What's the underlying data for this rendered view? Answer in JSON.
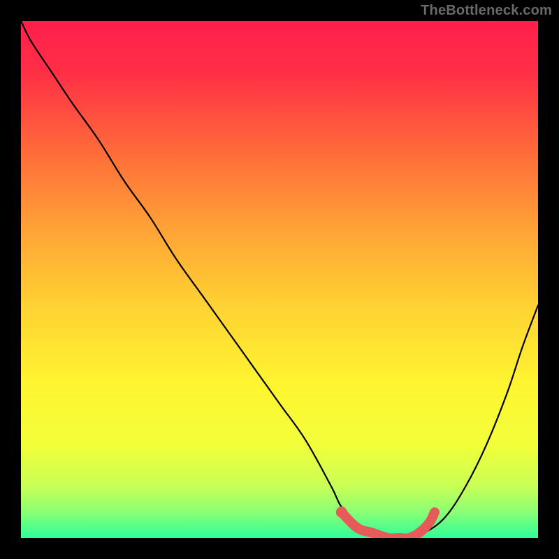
{
  "watermark": "TheBottleneck.com",
  "colors": {
    "gradient_stops": [
      {
        "offset": 0.0,
        "color": "#ff1f4b"
      },
      {
        "offset": 0.1,
        "color": "#ff2f46"
      },
      {
        "offset": 0.25,
        "color": "#ff6a3a"
      },
      {
        "offset": 0.4,
        "color": "#ffa236"
      },
      {
        "offset": 0.55,
        "color": "#ffd233"
      },
      {
        "offset": 0.7,
        "color": "#fff430"
      },
      {
        "offset": 0.82,
        "color": "#f2ff3a"
      },
      {
        "offset": 0.9,
        "color": "#c8ff55"
      },
      {
        "offset": 0.95,
        "color": "#8bff76"
      },
      {
        "offset": 1.0,
        "color": "#2dff9a"
      }
    ],
    "curve": "#000000",
    "highlight": "#e65a5a"
  },
  "chart_data": {
    "type": "line",
    "title": "",
    "xlabel": "",
    "ylabel": "",
    "xlim": [
      0,
      100
    ],
    "ylim": [
      0,
      100
    ],
    "series": [
      {
        "name": "bottleneck-curve",
        "x": [
          0,
          2,
          6,
          10,
          15,
          20,
          25,
          30,
          35,
          40,
          45,
          50,
          55,
          60,
          62,
          65,
          68,
          72,
          75,
          78,
          82,
          86,
          90,
          94,
          97,
          100
        ],
        "y": [
          100,
          96,
          90,
          84,
          77,
          69,
          62,
          54,
          47,
          40,
          33,
          26,
          19,
          10,
          6,
          3,
          1,
          0,
          0,
          1,
          4,
          10,
          18,
          28,
          37,
          45
        ]
      },
      {
        "name": "optimal-region-highlight",
        "x": [
          62,
          65,
          68,
          71,
          73,
          75,
          77,
          79,
          80
        ],
        "y": [
          5,
          2,
          1,
          0,
          0,
          0,
          1,
          3,
          5
        ]
      }
    ]
  }
}
